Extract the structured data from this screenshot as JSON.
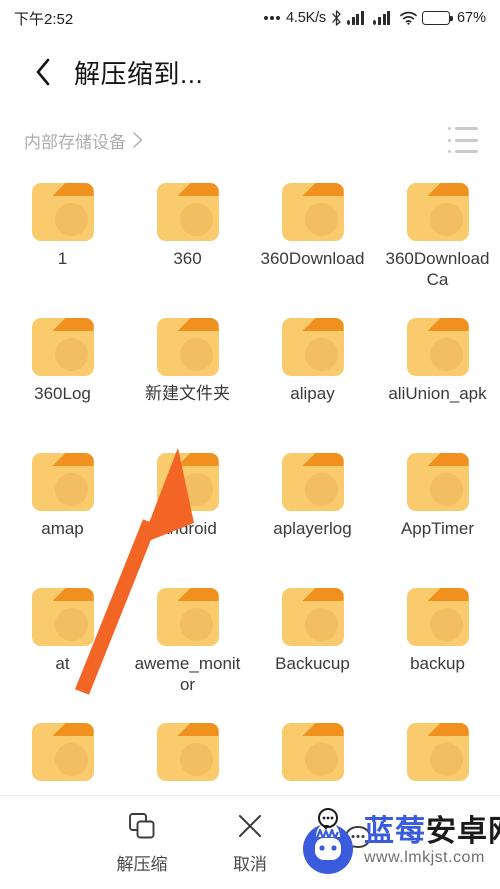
{
  "status_bar": {
    "time": "下午2:52",
    "network_speed": "4.5K/s",
    "battery_percent": "67%",
    "battery_level": 67,
    "icons": [
      "dots-icon",
      "bluetooth-icon",
      "signal-icon",
      "signal-icon",
      "wifi-icon",
      "battery-icon"
    ]
  },
  "app_bar": {
    "back_label": "back-chevron",
    "title": "解压缩到..."
  },
  "breadcrumb": {
    "path_label": "内部存储设备",
    "chevron": "›",
    "view_toggle": "list-view-icon"
  },
  "grid": {
    "columns": 4,
    "items": [
      {
        "name": "1",
        "type": "folder"
      },
      {
        "name": "360",
        "type": "folder"
      },
      {
        "name": "360Download",
        "type": "folder"
      },
      {
        "name": "360DownloadCa",
        "type": "folder"
      },
      {
        "name": "360Log",
        "type": "folder"
      },
      {
        "name": "新建文件夹",
        "type": "folder"
      },
      {
        "name": "alipay",
        "type": "folder"
      },
      {
        "name": "aliUnion_apk",
        "type": "folder"
      },
      {
        "name": "amap",
        "type": "folder"
      },
      {
        "name": "Android",
        "type": "folder"
      },
      {
        "name": "aplayerlog",
        "type": "folder"
      },
      {
        "name": "AppTimer",
        "type": "folder"
      },
      {
        "name": "at",
        "type": "folder"
      },
      {
        "name": "aweme_monitor",
        "type": "folder"
      },
      {
        "name": "Backucup",
        "type": "folder"
      },
      {
        "name": "backup",
        "type": "folder"
      },
      {
        "name": "",
        "type": "folder"
      },
      {
        "name": "",
        "type": "folder"
      },
      {
        "name": "",
        "type": "folder"
      },
      {
        "name": "",
        "type": "folder"
      }
    ]
  },
  "annotation": {
    "type": "arrow",
    "color": "#f26524",
    "points_at": "新建文件夹"
  },
  "bottom_bar": {
    "items": [
      {
        "label": "解压缩",
        "icon": "extract-copy-icon"
      },
      {
        "label": "取消",
        "icon": "close-x-icon"
      },
      {
        "label": "",
        "icon": "more-bubble-icon"
      }
    ]
  },
  "watermark": {
    "brand_blue": "蓝莓",
    "brand_dark": "安卓网",
    "url": "www.lmkjst.com",
    "logo": "android-mascot-icon"
  },
  "colors": {
    "folder_body": "#f9cb6d",
    "folder_tab": "#f0901f",
    "arrow": "#f26524",
    "text_primary": "#3a3a3a",
    "text_muted": "#adadad",
    "brand_blue": "#3a5bdb"
  }
}
